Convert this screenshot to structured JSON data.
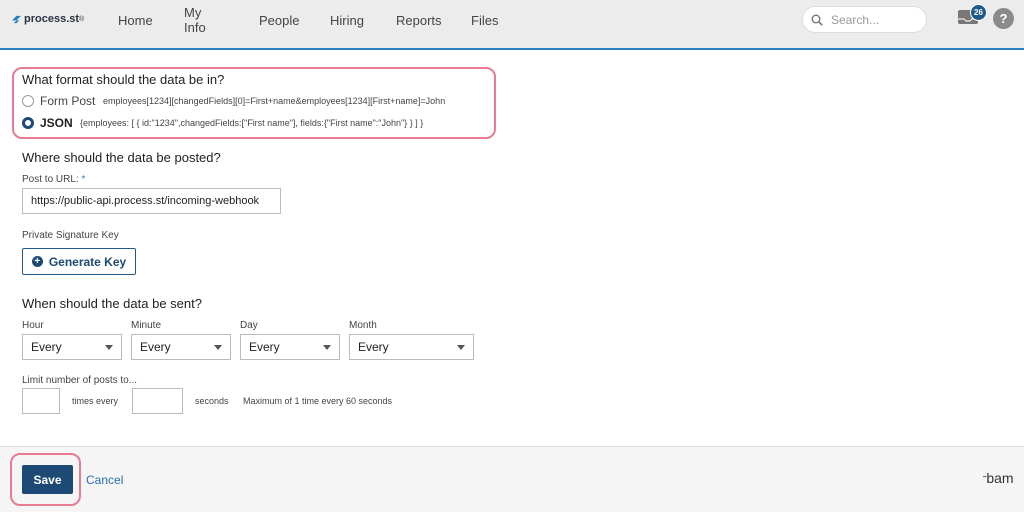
{
  "header": {
    "logo_text": "process.st",
    "nav": [
      "Home",
      "My Info",
      "People",
      "Hiring",
      "Reports",
      "Files"
    ],
    "search_placeholder": "Search...",
    "inbox_count": "26",
    "help_label": "?"
  },
  "format": {
    "heading": "What format should the data be in?",
    "options": [
      {
        "label": "Form Post",
        "example": "employees[1234][changedFields][0]=First+name&employees[1234][First+name]=John",
        "selected": false
      },
      {
        "label": "JSON",
        "example": "{employees: [ { id:\"1234\",changedFields:[\"First name\"], fields:{\"First name\":\"John\"} } ] }",
        "selected": true
      }
    ]
  },
  "post": {
    "heading": "Where should the data be posted?",
    "url_label": "Post to URL:",
    "required_mark": "*",
    "url_value": "https://public-api.process.st/incoming-webhook",
    "signature_label": "Private Signature Key",
    "generate_label": "Generate Key"
  },
  "schedule": {
    "heading": "When should the data be sent?",
    "fields": [
      {
        "label": "Hour",
        "value": "Every"
      },
      {
        "label": "Minute",
        "value": "Every"
      },
      {
        "label": "Day",
        "value": "Every"
      },
      {
        "label": "Month",
        "value": "Every"
      }
    ],
    "limit_label": "Limit number of posts to...",
    "times_every": "times every",
    "seconds": "seconds",
    "max_note": "Maximum of 1 time every 60 seconds"
  },
  "footer": {
    "save_label": "Save",
    "cancel_label": "Cancel",
    "brand": "bamboo"
  },
  "colors": {
    "accent": "#1d4a74",
    "highlight": "#e87b93",
    "link": "#2a6fb0"
  }
}
